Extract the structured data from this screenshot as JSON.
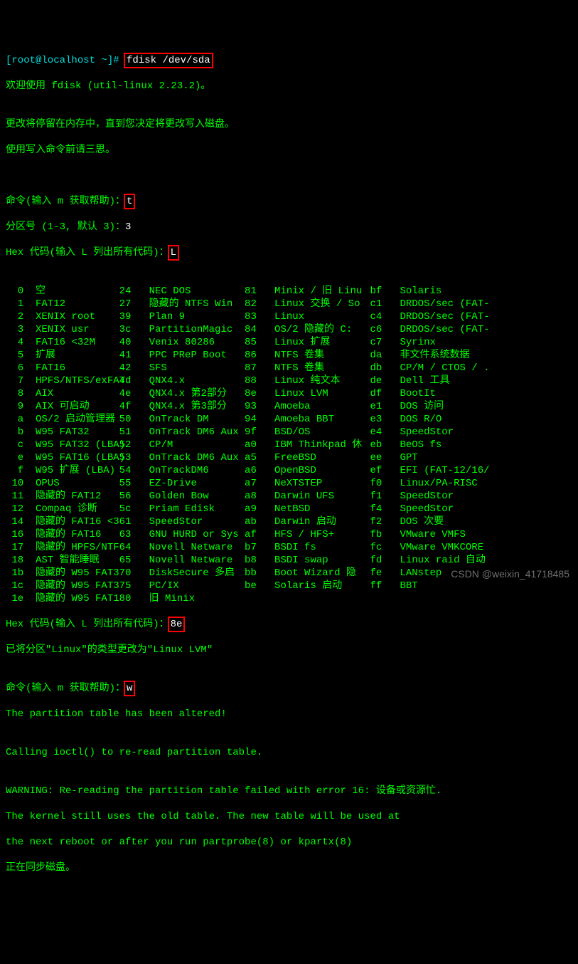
{
  "prompt_prefix": "[root@localhost ~]# ",
  "cmd": "fdisk /dev/sda",
  "welcome": "欢迎使用 fdisk (util-linux 2.23.2)。",
  "blank": "",
  "info1": "更改将停留在内存中，直到您决定将更改写入磁盘。",
  "info2": "使用写入命令前请三思。",
  "cmd_help_prefix": "命令(输入 m 获取帮助)：",
  "t_input": "t",
  "part_line_prefix": "分区号 (1-3, 默认 3)：",
  "part_input": "3",
  "hex_prefix": "Hex 代码(输入 L 列出所有代码)：",
  "l_input": "L",
  "types": [
    [
      " 0",
      "空",
      "24",
      "NEC DOS",
      "81",
      "Minix / 旧 Linu",
      "bf",
      "Solaris"
    ],
    [
      " 1",
      "FAT12",
      "27",
      "隐藏的 NTFS Win",
      "82",
      "Linux 交换 / So",
      "c1",
      "DRDOS/sec (FAT-"
    ],
    [
      " 2",
      "XENIX root",
      "39",
      "Plan 9",
      "83",
      "Linux",
      "c4",
      "DRDOS/sec (FAT-"
    ],
    [
      " 3",
      "XENIX usr",
      "3c",
      "PartitionMagic",
      "84",
      "OS/2 隐藏的 C:",
      "c6",
      "DRDOS/sec (FAT-"
    ],
    [
      " 4",
      "FAT16 <32M",
      "40",
      "Venix 80286",
      "85",
      "Linux 扩展",
      "c7",
      "Syrinx"
    ],
    [
      " 5",
      "扩展",
      "41",
      "PPC PReP Boot",
      "86",
      "NTFS 卷集",
      "da",
      "非文件系统数据"
    ],
    [
      " 6",
      "FAT16",
      "42",
      "SFS",
      "87",
      "NTFS 卷集",
      "db",
      "CP/M / CTOS / ."
    ],
    [
      " 7",
      "HPFS/NTFS/exFAT",
      "4d",
      "QNX4.x",
      "88",
      "Linux 纯文本",
      "de",
      "Dell 工具"
    ],
    [
      " 8",
      "AIX",
      "4e",
      "QNX4.x 第2部分",
      "8e",
      "Linux LVM",
      "df",
      "BootIt"
    ],
    [
      " 9",
      "AIX 可启动",
      "4f",
      "QNX4.x 第3部分",
      "93",
      "Amoeba",
      "e1",
      "DOS 访问"
    ],
    [
      " a",
      "OS/2 启动管理器",
      "50",
      "OnTrack DM",
      "94",
      "Amoeba BBT",
      "e3",
      "DOS R/O"
    ],
    [
      " b",
      "W95 FAT32",
      "51",
      "OnTrack DM6 Aux",
      "9f",
      "BSD/OS",
      "e4",
      "SpeedStor"
    ],
    [
      " c",
      "W95 FAT32 (LBA)",
      "52",
      "CP/M",
      "a0",
      "IBM Thinkpad 休",
      "eb",
      "BeOS fs"
    ],
    [
      " e",
      "W95 FAT16 (LBA)",
      "53",
      "OnTrack DM6 Aux",
      "a5",
      "FreeBSD",
      "ee",
      "GPT"
    ],
    [
      " f",
      "W95 扩展 (LBA)",
      "54",
      "OnTrackDM6",
      "a6",
      "OpenBSD",
      "ef",
      "EFI (FAT-12/16/"
    ],
    [
      "10",
      "OPUS",
      "55",
      "EZ-Drive",
      "a7",
      "NeXTSTEP",
      "f0",
      "Linux/PA-RISC"
    ],
    [
      "11",
      "隐藏的 FAT12",
      "56",
      "Golden Bow",
      "a8",
      "Darwin UFS",
      "f1",
      "SpeedStor"
    ],
    [
      "12",
      "Compaq 诊断",
      "5c",
      "Priam Edisk",
      "a9",
      "NetBSD",
      "f4",
      "SpeedStor"
    ],
    [
      "14",
      "隐藏的 FAT16 <3",
      "61",
      "SpeedStor",
      "ab",
      "Darwin 启动",
      "f2",
      "DOS 次要"
    ],
    [
      "16",
      "隐藏的 FAT16",
      "63",
      "GNU HURD or Sys",
      "af",
      "HFS / HFS+",
      "fb",
      "VMware VMFS"
    ],
    [
      "17",
      "隐藏的 HPFS/NTF",
      "64",
      "Novell Netware",
      "b7",
      "BSDI fs",
      "fc",
      "VMware VMKCORE"
    ],
    [
      "18",
      "AST 智能睡眠",
      "65",
      "Novell Netware",
      "b8",
      "BSDI swap",
      "fd",
      "Linux raid 自动"
    ],
    [
      "1b",
      "隐藏的 W95 FAT3",
      "70",
      "DiskSecure 多启",
      "bb",
      "Boot Wizard 隐",
      "fe",
      "LANstep"
    ],
    [
      "1c",
      "隐藏的 W95 FAT3",
      "75",
      "PC/IX",
      "be",
      "Solaris 启动",
      "ff",
      "BBT"
    ],
    [
      "1e",
      "隐藏的 W95 FAT1",
      "80",
      "旧 Minix",
      "",
      "",
      "",
      ""
    ]
  ],
  "hex_input2": "8e",
  "changed": "已将分区\"Linux\"的类型更改为\"Linux LVM\"",
  "w_input": "w",
  "altered": "The partition table has been altered!",
  "ioctl": "Calling ioctl() to re-read partition table.",
  "warn1": "WARNING: Re-reading the partition table failed with error 16: 设备或资源忙.",
  "warn2": "The kernel still uses the old table. The new table will be used at",
  "warn3": "the next reboot or after you run partprobe(8) or kpartx(8)",
  "sync": "正在同步磁盘。",
  "watermark": "CSDN @weixin_41718485"
}
